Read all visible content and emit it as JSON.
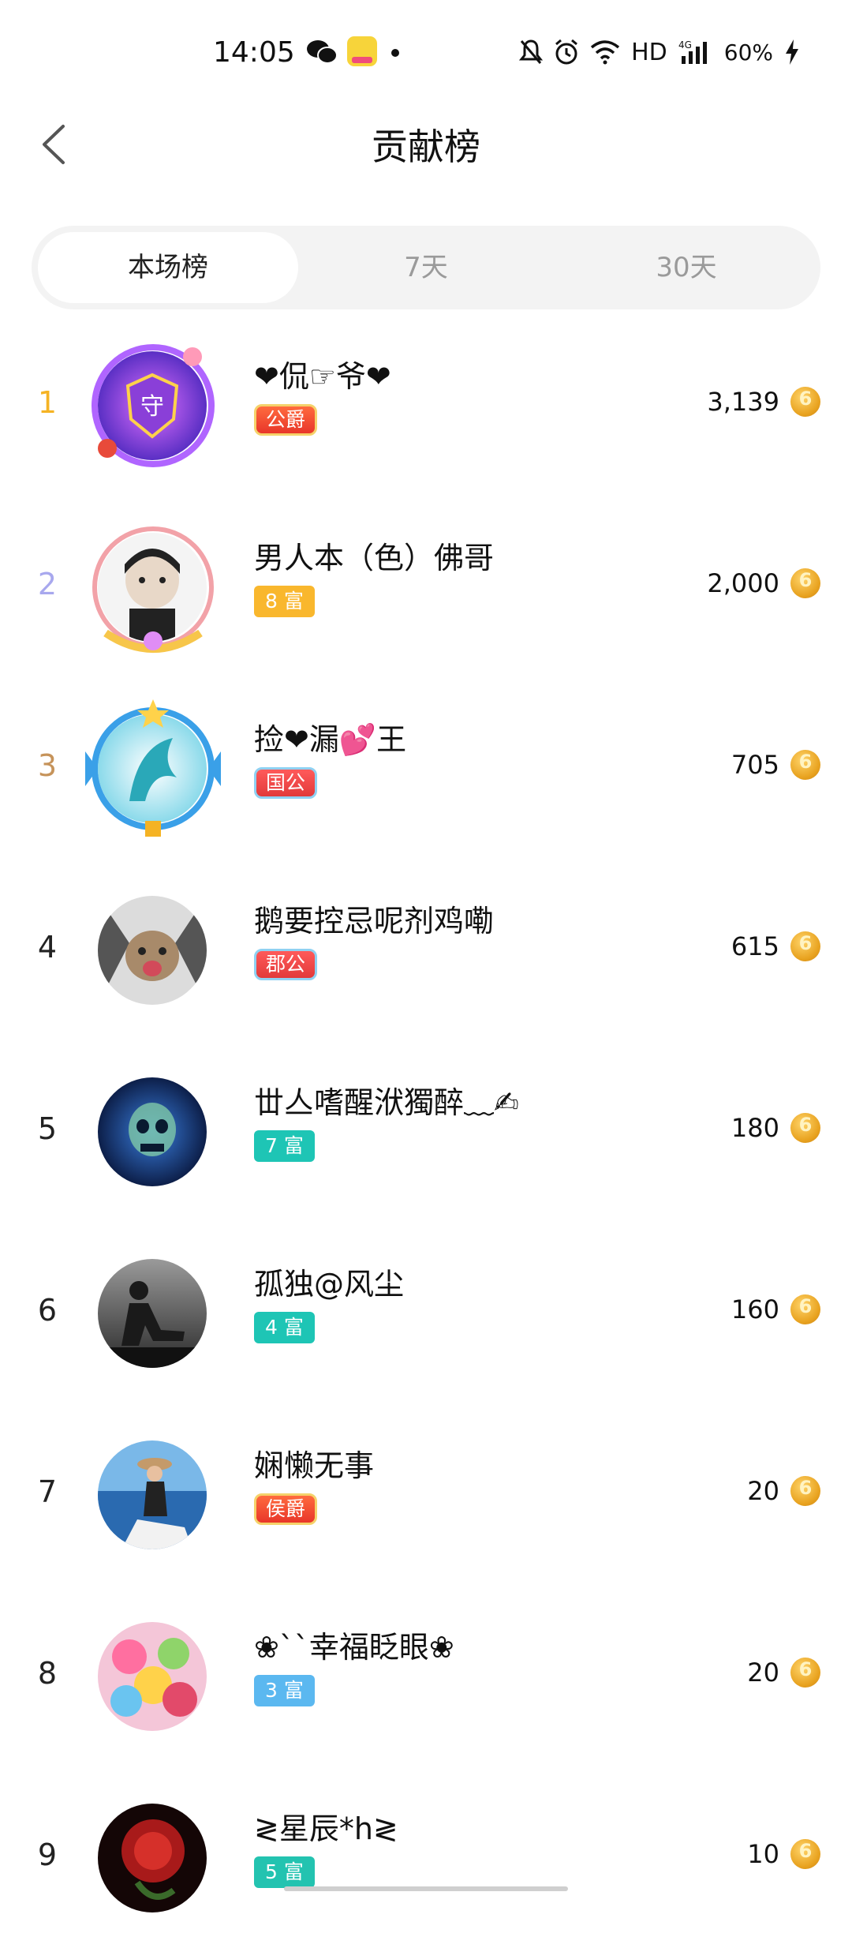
{
  "status_bar": {
    "time": "14:05",
    "network_label": "HD",
    "network_type": "4G",
    "battery": "60%",
    "icons": [
      "wechat-icon",
      "app-notification-icon",
      "dot-icon",
      "mute-icon",
      "alarm-icon",
      "wifi-icon",
      "signal-icon",
      "charging-icon"
    ]
  },
  "header": {
    "title": "贡献榜"
  },
  "tabs": [
    {
      "label": "本场榜",
      "active": true
    },
    {
      "label": "7天",
      "active": false
    },
    {
      "label": "30天",
      "active": false
    }
  ],
  "list": [
    {
      "rank": "1",
      "name": "❤侃☞爷❤",
      "badge": "公爵",
      "badge_type": "noble",
      "score": "3,139"
    },
    {
      "rank": "2",
      "name": "男人本（色）佛哥",
      "badge": "8 富",
      "badge_type": "fortune-8",
      "score": "2,000"
    },
    {
      "rank": "3",
      "name": "捡❤漏💕王",
      "badge": "国公",
      "badge_type": "noble",
      "score": "705"
    },
    {
      "rank": "4",
      "name": "鹅要控忌呢剂鸡嘞",
      "badge": "郡公",
      "badge_type": "noble",
      "score": "615"
    },
    {
      "rank": "5",
      "name": "丗亼嗜醒洑獨醉﹏✍",
      "badge": "7 富",
      "badge_type": "fortune-7",
      "score": "180"
    },
    {
      "rank": "6",
      "name": "孤独@风尘",
      "badge": "4 富",
      "badge_type": "fortune-4",
      "score": "160"
    },
    {
      "rank": "7",
      "name": "娴懒无事",
      "badge": "侯爵",
      "badge_type": "noble",
      "score": "20"
    },
    {
      "rank": "8",
      "name": "❀``幸福眨眼❀",
      "badge": "3 富",
      "badge_type": "fortune-3",
      "score": "20"
    },
    {
      "rank": "9",
      "name": "≷星辰*h≷",
      "badge": "5 富",
      "badge_type": "fortune-5",
      "score": "10"
    }
  ],
  "colors": {
    "rank1": "#f5b324",
    "rank2": "#a8a8ee",
    "rank3": "#c6935a",
    "coin": "#e8a21f",
    "tab_bg": "#f3f3f3"
  }
}
